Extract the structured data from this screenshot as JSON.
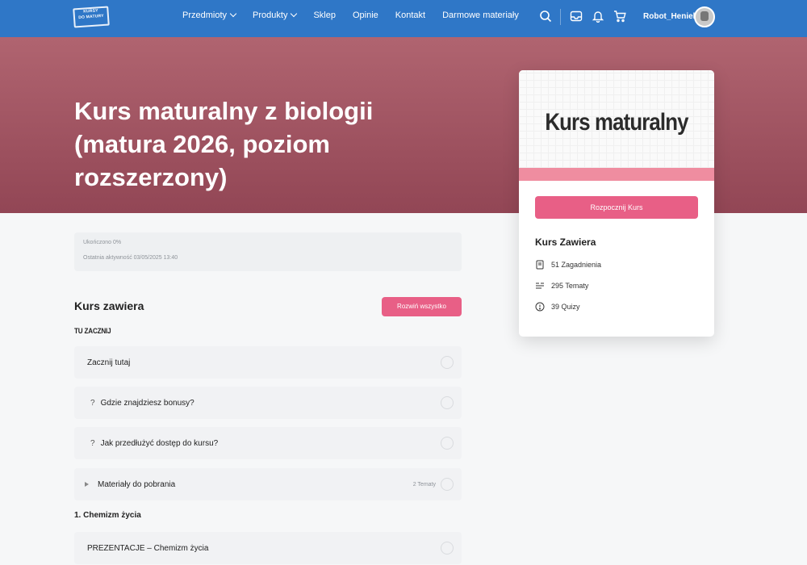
{
  "header": {
    "logo_text": [
      "KURSY",
      "DO MATURY"
    ],
    "nav": [
      {
        "label": "Przedmioty",
        "dropdown": true
      },
      {
        "label": "Produkty",
        "dropdown": true
      },
      {
        "label": "Sklep",
        "dropdown": false
      },
      {
        "label": "Opinie",
        "dropdown": false
      },
      {
        "label": "Kontakt",
        "dropdown": false
      },
      {
        "label": "Darmowe materiały",
        "dropdown": false
      }
    ],
    "icons": [
      "search-icon",
      "inbox-icon",
      "bell-icon",
      "cart-icon"
    ],
    "username": "Robot_Heniek"
  },
  "hero": {
    "title": "Kurs maturalny z biologii (matura 2026, poziom rozszerzony)"
  },
  "card": {
    "image_title": "Kurs maturalny",
    "start_label": "Rozpocznij Kurs",
    "contains_heading": "Kurs Zawiera",
    "stats": [
      {
        "icon": "book-icon",
        "text": "51 Zagadnienia"
      },
      {
        "icon": "list-icon",
        "text": "295 Tematy"
      },
      {
        "icon": "quiz-icon",
        "text": "39 Quizy"
      }
    ]
  },
  "progress": {
    "completed": "Ukończono 0%",
    "last_activity": "Ostatnia aktywność 03/05/2025 13:40"
  },
  "content": {
    "heading": "Kurs zawiera",
    "expand_label": "Rozwiń wszystko",
    "group_label": "TU ZACZNIJ",
    "rows": [
      {
        "label": "Zacznij tutaj",
        "prefix": "",
        "count": ""
      },
      {
        "label": "Gdzie znajdziesz bonusy?",
        "prefix": "?",
        "count": ""
      },
      {
        "label": "Jak przedłużyć dostęp do kursu?",
        "prefix": "?",
        "count": ""
      },
      {
        "label": "Materiały do pobrania",
        "prefix": "▸",
        "count": "2 Tematy"
      }
    ],
    "section_1": "1. Chemizm życia",
    "section_1_rows": [
      {
        "label": "PREZENTACJE – Chemizm życia"
      }
    ]
  }
}
